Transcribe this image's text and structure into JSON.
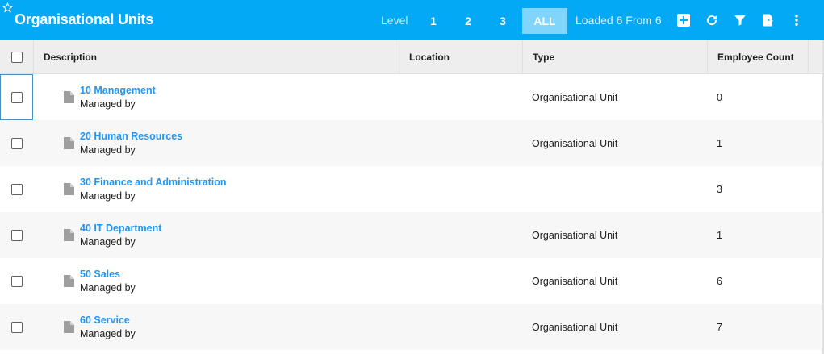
{
  "toolbar": {
    "title": "Organisational Units",
    "level_label": "Level",
    "levels": [
      "1",
      "2",
      "3",
      "ALL"
    ],
    "active_level": "ALL",
    "loaded_text": "Loaded 6 From 6"
  },
  "table": {
    "columns": [
      "Description",
      "Location",
      "Type",
      "Employee Count"
    ],
    "rows": [
      {
        "name": "10 Management",
        "sub": "Managed by",
        "location": "",
        "type": "Organisational Unit",
        "count": "0"
      },
      {
        "name": "20 Human Resources",
        "sub": "Managed by",
        "location": "",
        "type": "Organisational Unit",
        "count": "1"
      },
      {
        "name": "30 Finance and Administration",
        "sub": "Managed by",
        "location": "",
        "type": "",
        "count": "3"
      },
      {
        "name": "40 IT Department",
        "sub": "Managed by",
        "location": "",
        "type": "Organisational Unit",
        "count": "1"
      },
      {
        "name": "50 Sales",
        "sub": "Managed by",
        "location": "",
        "type": "Organisational Unit",
        "count": "6"
      },
      {
        "name": "60 Service",
        "sub": "Managed by",
        "location": "",
        "type": "Organisational Unit",
        "count": "7"
      }
    ]
  },
  "colors": {
    "toolbar_bg": "#03a9f4",
    "active_level_bg": "#81d4fa",
    "link": "#2196f3"
  }
}
